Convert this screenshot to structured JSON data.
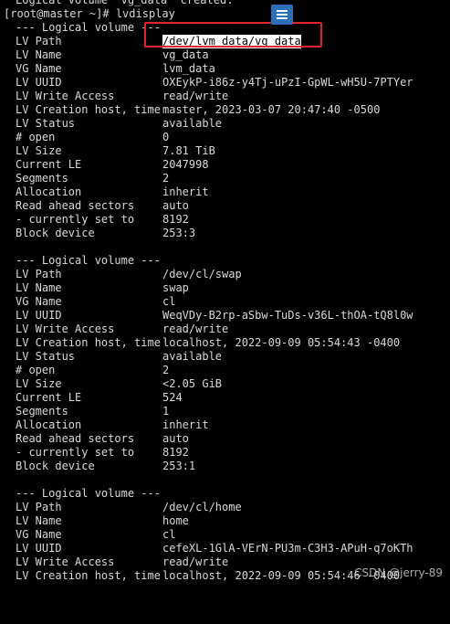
{
  "top_partial": "Logical volume \"vg_data\" created.",
  "prompt": "[root@master ~]#",
  "command": "lvdisplay",
  "volumes": [
    {
      "header": "--- Logical volume ---",
      "lv_path": "/dev/lvm_data/vg_data",
      "lv_name": "vg_data",
      "vg_name": "lvm_data",
      "lv_uuid": "OXEykP-i86z-y4Tj-uPzI-GpWL-wH5U-7PTYer",
      "write_access": "read/write",
      "creation": "master, 2023-03-07 20:47:40 -0500",
      "status": "available",
      "open": "0",
      "size": "7.81 TiB",
      "current_le": "2047998",
      "segments": "2",
      "allocation": "inherit",
      "read_ahead": "auto",
      "currently_set_to": "8192",
      "block_device": "253:3"
    },
    {
      "header": "--- Logical volume ---",
      "lv_path": "/dev/cl/swap",
      "lv_name": "swap",
      "vg_name": "cl",
      "lv_uuid": "WeqVDy-B2rp-aSbw-TuDs-v36L-thOA-tQ8l0w",
      "write_access": "read/write",
      "creation": "localhost, 2022-09-09 05:54:43 -0400",
      "status": "available",
      "open": "2",
      "size": "<2.05 GiB",
      "current_le": "524",
      "segments": "1",
      "allocation": "inherit",
      "read_ahead": "auto",
      "currently_set_to": "8192",
      "block_device": "253:1"
    },
    {
      "header": "--- Logical volume ---",
      "lv_path": "/dev/cl/home",
      "lv_name": "home",
      "vg_name": "cl",
      "lv_uuid": "cefeXL-1GlA-VErN-PU3m-C3H3-APuH-q7oKTh",
      "write_access": "read/write",
      "creation": "localhost, 2022-09-09 05:54:46 -0400"
    }
  ],
  "labels": {
    "lv_path": "LV Path",
    "lv_name": "LV Name",
    "vg_name": "VG Name",
    "lv_uuid": "LV UUID",
    "write_access": "LV Write Access",
    "creation": "LV Creation host, time",
    "status": "LV Status",
    "open": "# open",
    "size": "LV Size",
    "current_le": "Current LE",
    "segments": "Segments",
    "allocation": "Allocation",
    "read_ahead": "Read ahead sectors",
    "currently_set_to": "- currently set to",
    "block_device": "Block device"
  },
  "watermark": "CSDN @jerry-89",
  "colors": {
    "background": "#000000",
    "text": "#d8d8d8",
    "highlight_box": "#e0242b",
    "menu_icon": "#2b6fb8"
  },
  "icons": {
    "menu": "hamburger-menu-icon"
  }
}
